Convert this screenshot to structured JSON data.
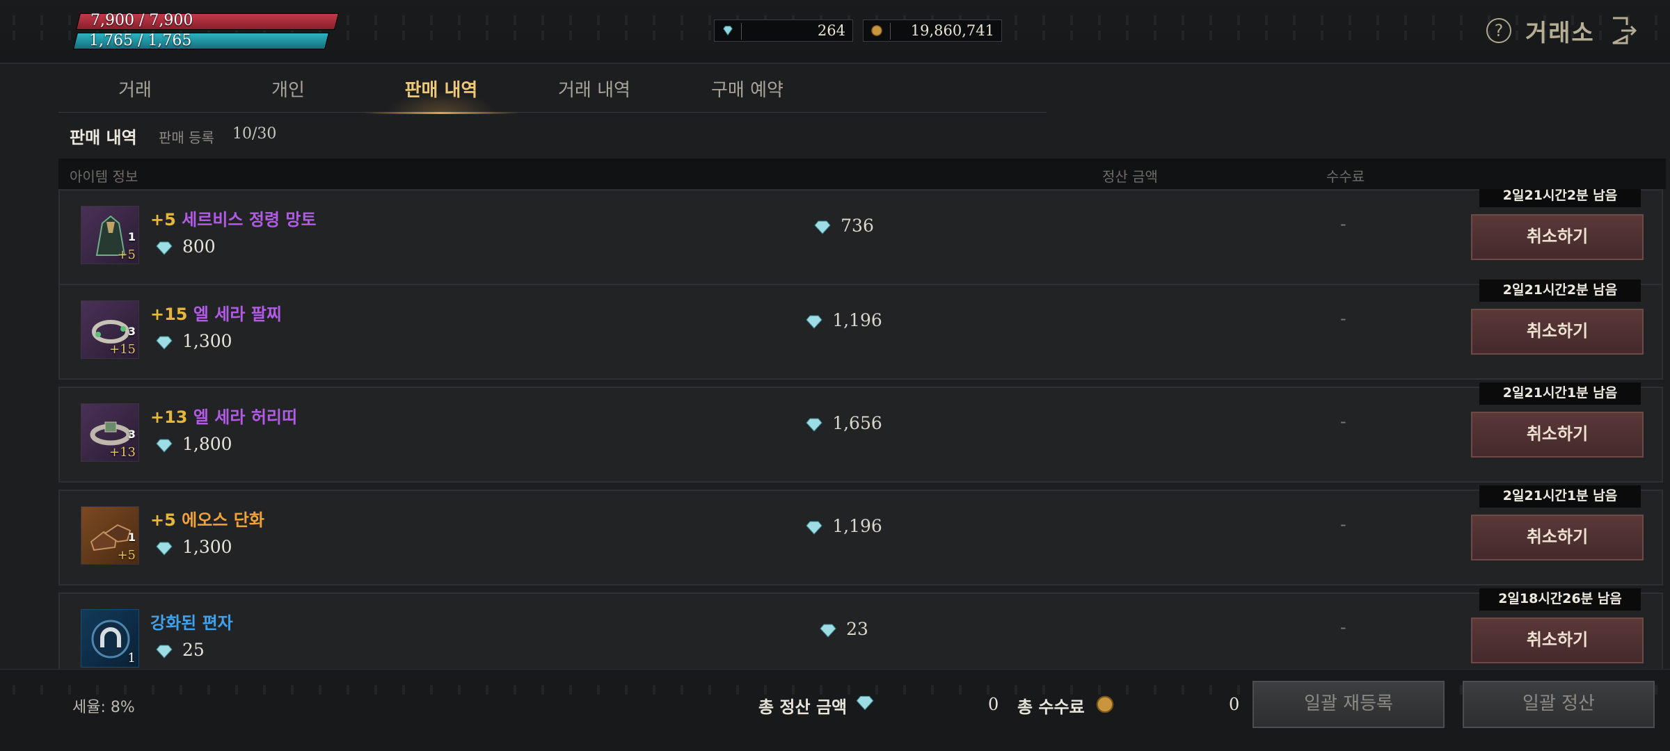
{
  "status": {
    "hp": "7,900 / 7,900",
    "mp": "1,765 / 1,765",
    "hp_fraction": 1.0,
    "mp_fraction": 1.0
  },
  "currency": {
    "diamonds": "264",
    "gold": "19,860,741"
  },
  "header": {
    "title": "거래소",
    "help_icon": "question-circle-icon",
    "exit_icon": "exit-door-icon"
  },
  "tabs": [
    {
      "label": "거래"
    },
    {
      "label": "개인"
    },
    {
      "label": "판매 내역"
    },
    {
      "label": "거래 내역"
    },
    {
      "label": "구매 예약"
    }
  ],
  "active_tab": 2,
  "section": {
    "title": "판매 내역",
    "registration_label": "판매 등록",
    "registration_count": "10/30"
  },
  "columns": {
    "item_info": "아이템 정보",
    "settlement": "정산 금액",
    "fee": "수수료"
  },
  "items": [
    {
      "plus": "+5",
      "name": "세르비스 정령 망토",
      "name_color": "purple",
      "price": "800",
      "settle": "736",
      "fee": "-",
      "timer": "2일21시간2분 남음",
      "cancel": "취소하기",
      "thumb_level": "+5",
      "thumb_count": "1",
      "icon": "cloak-icon"
    },
    {
      "plus": "+15",
      "name": "엘 세라 팔찌",
      "name_color": "purple",
      "price": "1,300",
      "settle": "1,196",
      "fee": "-",
      "timer": "2일21시간2분 남음",
      "cancel": "취소하기",
      "thumb_level": "+15",
      "thumb_count": "3",
      "icon": "bracelet-icon"
    },
    {
      "plus": "+13",
      "name": "엘 세라 허리띠",
      "name_color": "purple",
      "price": "1,800",
      "settle": "1,656",
      "fee": "-",
      "timer": "2일21시간1분 남음",
      "cancel": "취소하기",
      "thumb_level": "+13",
      "thumb_count": "3",
      "icon": "belt-icon"
    },
    {
      "plus": "+5",
      "name": "에오스 단화",
      "name_color": "orange",
      "price": "1,300",
      "settle": "1,196",
      "fee": "-",
      "timer": "2일21시간1분 남음",
      "cancel": "취소하기",
      "thumb_level": "+5",
      "thumb_count": "1",
      "icon": "shoes-icon"
    },
    {
      "plus": "",
      "name": "강화된 편자",
      "name_color": "blue",
      "price": "25",
      "settle": "23",
      "fee": "-",
      "timer": "2일18시간26분 남음",
      "cancel": "취소하기",
      "thumb_level": "1",
      "thumb_count": "",
      "icon": "horseshoe-icon"
    }
  ],
  "footer": {
    "tax": "세율: 8%",
    "total_label": "총 정산 금액",
    "total_value": "0",
    "fee_label": "총 수수료",
    "fee_value": "0",
    "relist_button": "일괄 재등록",
    "settle_button": "일괄 정산"
  },
  "colors": {
    "accent": "#f0c978",
    "hp": "#c23a4a",
    "mp": "#2db3c2",
    "cancel": "#5a3838"
  }
}
